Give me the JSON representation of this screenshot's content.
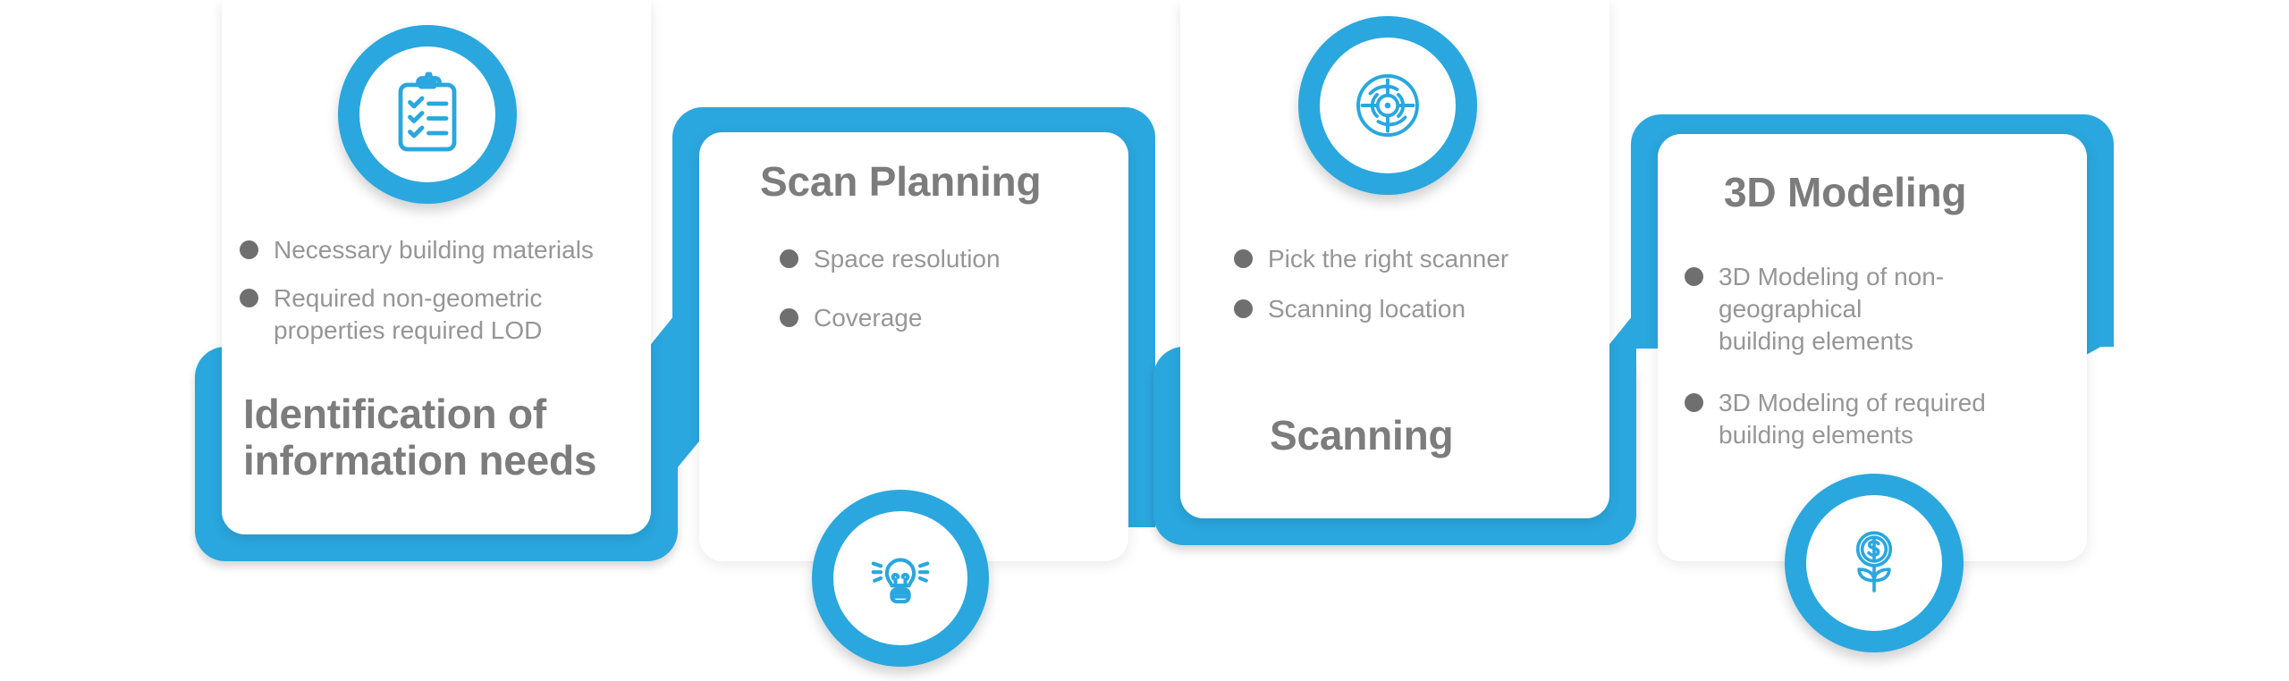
{
  "theme": {
    "accent": "#2aa7de",
    "title_color": "#7c7c7c",
    "bullet_text_color": "#969696",
    "bullet_dot_color": "#6f6f6f",
    "card_bg": "#ffffff",
    "page_bg": "#ffffff"
  },
  "diagram": {
    "type": "process-flow",
    "step_count": 4,
    "steps": [
      {
        "index": 1,
        "title": "Identification of\ninformation needs",
        "icon": "clipboard-checklist-icon",
        "icon_position": "top",
        "title_position": "bottom",
        "style": "framed",
        "bullets": [
          "Necessary building materials",
          "Required non-geometric\nproperties required LOD"
        ]
      },
      {
        "index": 2,
        "title": "Scan Planning",
        "icon": "lightbulb-icon",
        "icon_position": "bottom",
        "title_position": "top",
        "style": "plain",
        "bullets": [
          "Space resolution",
          "Coverage"
        ]
      },
      {
        "index": 3,
        "title": "Scanning",
        "icon": "target-scanner-icon",
        "icon_position": "top",
        "title_position": "bottom",
        "style": "framed",
        "bullets": [
          "Pick the right scanner",
          "Scanning location"
        ]
      },
      {
        "index": 4,
        "title": "3D Modeling",
        "icon": "money-plant-growth-icon",
        "icon_position": "bottom",
        "title_position": "top",
        "style": "plain",
        "bullets": [
          "3D Modeling of non-geographical\nbuilding elements",
          "3D Modeling of required\nbuilding elements"
        ]
      }
    ]
  }
}
